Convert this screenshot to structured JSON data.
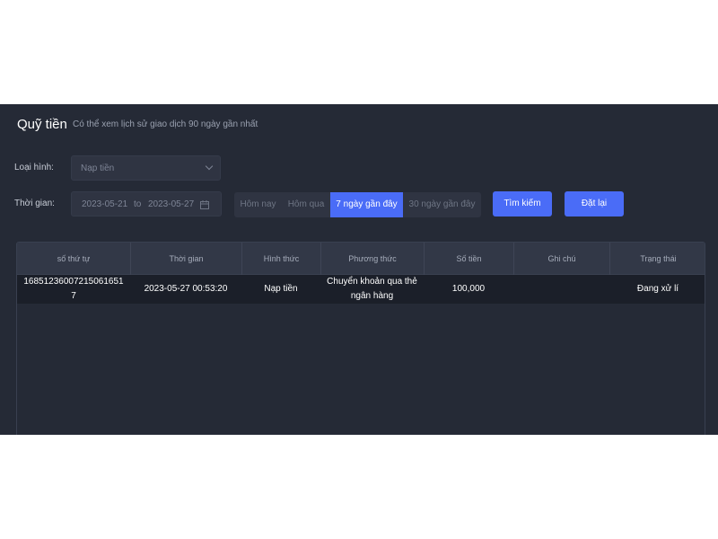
{
  "header": {
    "title": "Quỹ tiền",
    "subtitle": "Có thể xem lịch sử giao dịch 90 ngày gần nhất"
  },
  "filters": {
    "type_label": "Loại hình:",
    "type_value": "Nạp tiền",
    "time_label": "Thời gian:",
    "date_start": "2023-05-21",
    "date_sep": "to",
    "date_end": "2023-05-27",
    "quick_ranges": [
      "Hôm nay",
      "Hôm qua",
      "7 ngày gần đây",
      "30 ngày gần đây"
    ],
    "selected_range": "7 ngày gần đây",
    "search_label": "Tìm kiếm",
    "reset_label": "Đặt lại"
  },
  "table": {
    "columns": [
      "số thứ tự",
      "Thời gian",
      "Hình thức",
      "Phương thức",
      "Số tiền",
      "Ghi chú",
      "Trạng thái"
    ],
    "rows": [
      {
        "id": "168512360072150616517",
        "time": "2023-05-27 00:53:20",
        "type": "Nạp tiền",
        "method": "Chuyển khoản qua thẻ ngân hàng",
        "amount": "100,000",
        "note": "",
        "status": "Đang xử lí"
      }
    ]
  },
  "colors": {
    "panel_bg": "#252a36",
    "accent": "#4a6cf7",
    "row_bg": "#1b1f29"
  },
  "icons": [
    "chevron-down-icon",
    "calendar-icon"
  ]
}
